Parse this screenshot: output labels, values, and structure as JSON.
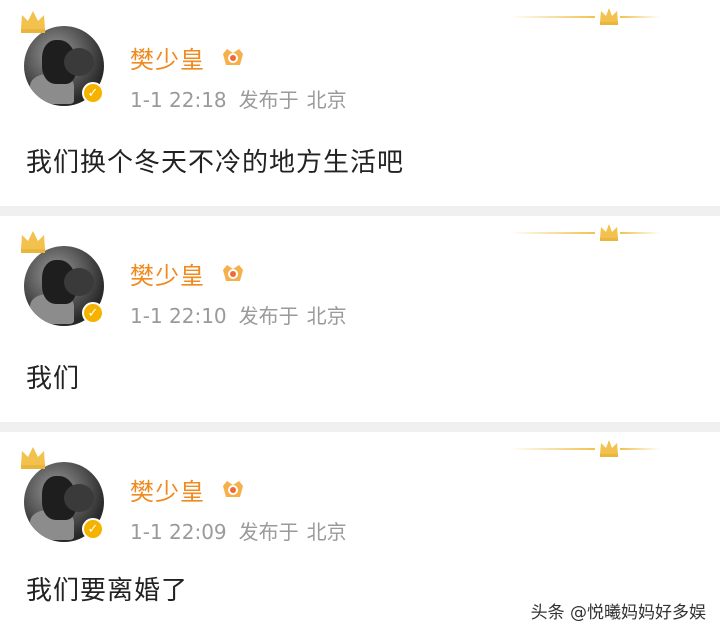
{
  "posts": [
    {
      "username": "樊少皇",
      "time": "1-1 22:18",
      "posted_at_label": "发布于",
      "location": "北京",
      "content": "我们换个冬天不冷的地方生活吧",
      "verified_mark": "✓"
    },
    {
      "username": "樊少皇",
      "time": "1-1 22:10",
      "posted_at_label": "发布于",
      "location": "北京",
      "content": "我们",
      "verified_mark": "✓"
    },
    {
      "username": "樊少皇",
      "time": "1-1 22:09",
      "posted_at_label": "发布于",
      "location": "北京",
      "content": "我们要离婚了",
      "verified_mark": "✓"
    }
  ],
  "watermark": "头条 @悦曦妈妈好多娱",
  "colors": {
    "username": "#ef8a1f",
    "meta": "#9a9a9a",
    "content": "#222222",
    "crown": "#f2c14e",
    "verify_badge": "#f5b300",
    "background": "#f0f0f0"
  },
  "icons": [
    "crown-icon",
    "vip-crown-badge-icon",
    "verified-badge-icon"
  ]
}
